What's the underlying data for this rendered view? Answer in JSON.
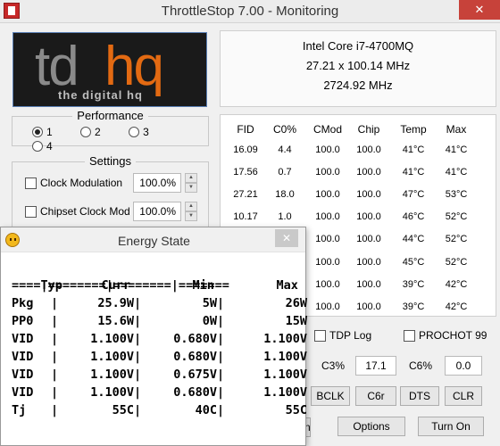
{
  "window": {
    "title": "ThrottleStop 7.00 - Monitoring",
    "close_glyph": "✕"
  },
  "logo": {
    "text": "tdhq",
    "tagline": "the digital hq"
  },
  "cpu": {
    "name": "Intel Core i7-4700MQ",
    "multiplier": "27.21 x 100.14 MHz",
    "frequency": "2724.92 MHz"
  },
  "performance": {
    "title": "Performance",
    "options": [
      {
        "label": "1",
        "selected": true
      },
      {
        "label": "2",
        "selected": false
      },
      {
        "label": "3",
        "selected": false
      },
      {
        "label": "4",
        "selected": false
      }
    ]
  },
  "settings": {
    "title": "Settings",
    "items": [
      {
        "label": "Clock Modulation",
        "value": "100.0%"
      },
      {
        "label": "Chipset Clock Mod",
        "value": "100.0%"
      }
    ]
  },
  "table": {
    "headers": [
      "FID",
      "C0%",
      "CMod",
      "Chip",
      "Temp",
      "Max"
    ],
    "rows": [
      [
        "16.09",
        "4.4",
        "100.0",
        "100.0",
        "41°C",
        "41°C"
      ],
      [
        "17.56",
        "0.7",
        "100.0",
        "100.0",
        "41°C",
        "41°C"
      ],
      [
        "27.21",
        "18.0",
        "100.0",
        "100.0",
        "47°C",
        "53°C"
      ],
      [
        "10.17",
        "1.0",
        "100.0",
        "100.0",
        "46°C",
        "52°C"
      ],
      [
        "",
        "",
        "100.0",
        "100.0",
        "44°C",
        "52°C"
      ],
      [
        "",
        "",
        "100.0",
        "100.0",
        "45°C",
        "52°C"
      ],
      [
        "",
        "",
        "100.0",
        "100.0",
        "39°C",
        "42°C"
      ],
      [
        "",
        "",
        "100.0",
        "100.0",
        "39°C",
        "42°C"
      ]
    ]
  },
  "checks": {
    "tdp_log": "TDP Log",
    "prochot": "PROCHOT 99"
  },
  "stats": {
    "c3_label": "C3%",
    "c3_value": "17.1",
    "c6_label": "C6%",
    "c6_value": "0.0"
  },
  "buttons": {
    "bclk": "BCLK",
    "c6r": "C6r",
    "dts": "DTS",
    "clr": "CLR",
    "partial": "n",
    "options": "Options",
    "turn_on": "Turn On"
  },
  "energy": {
    "title": "Energy State",
    "close_glyph": "✕",
    "header": {
      "typ": "Typ",
      "curr": "Curr",
      "min": "Min",
      "max": "Max"
    },
    "divider": "====|========|========|=======",
    "rows": [
      {
        "typ": "Pkg",
        "curr": "25.9W",
        "min": "5W",
        "max": "26W"
      },
      {
        "typ": "PP0",
        "curr": "15.6W",
        "min": "0W",
        "max": "15W"
      },
      {
        "typ": "VID",
        "curr": "1.100V",
        "min": "0.680V",
        "max": "1.100V"
      },
      {
        "typ": "VID",
        "curr": "1.100V",
        "min": "0.680V",
        "max": "1.100V"
      },
      {
        "typ": "VID",
        "curr": "1.100V",
        "min": "0.675V",
        "max": "1.100V"
      },
      {
        "typ": "VID",
        "curr": "1.100V",
        "min": "0.680V",
        "max": "1.100V"
      },
      {
        "typ": "Tj",
        "curr": "55C",
        "min": "40C",
        "max": "55C"
      }
    ]
  }
}
